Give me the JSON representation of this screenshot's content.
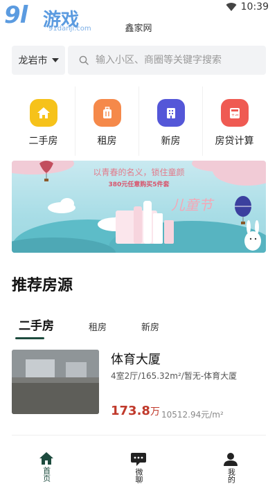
{
  "status_bar": {
    "time": "10:39"
  },
  "watermark": {
    "brand_big": "9l",
    "brand_cn": "游戏",
    "site": "91danji.com"
  },
  "header": {
    "title": "鑫家网"
  },
  "search": {
    "city": "龙岩市",
    "placeholder": "输入小区、商圈等关键字搜索"
  },
  "quick_nav": [
    {
      "label": "二手房",
      "icon": "home-icon",
      "color": "#f6c21a"
    },
    {
      "label": "租房",
      "icon": "luggage-icon",
      "color": "#f5894a"
    },
    {
      "label": "新房",
      "icon": "building-icon",
      "color": "#5457d8"
    },
    {
      "label": "房贷计算",
      "icon": "calculator-icon",
      "color": "#ef5a52"
    }
  ],
  "banner": {
    "line1": "以青春的名义，锁住童颜",
    "line2": "380元任意购买5件套",
    "brand": "儿童节"
  },
  "section": {
    "title": "推荐房源"
  },
  "tabs": [
    {
      "label": "二手房",
      "active": true
    },
    {
      "label": "租房",
      "active": false
    },
    {
      "label": "新房",
      "active": false
    }
  ],
  "listing": {
    "title": "体育大厦",
    "meta": "4室2厅/165.32m²/暂无-体育大厦",
    "price": "173.8",
    "price_unit": "万",
    "unit_price": "10512.94元/m²"
  },
  "bottom_nav": [
    {
      "label": "首页",
      "icon": "home-icon",
      "active": true
    },
    {
      "label": "微聊",
      "icon": "chat-icon",
      "active": false
    },
    {
      "label": "我的",
      "icon": "user-icon",
      "active": false
    }
  ],
  "colors": {
    "accent": "#1d4b3e",
    "price": "#c0392b"
  }
}
